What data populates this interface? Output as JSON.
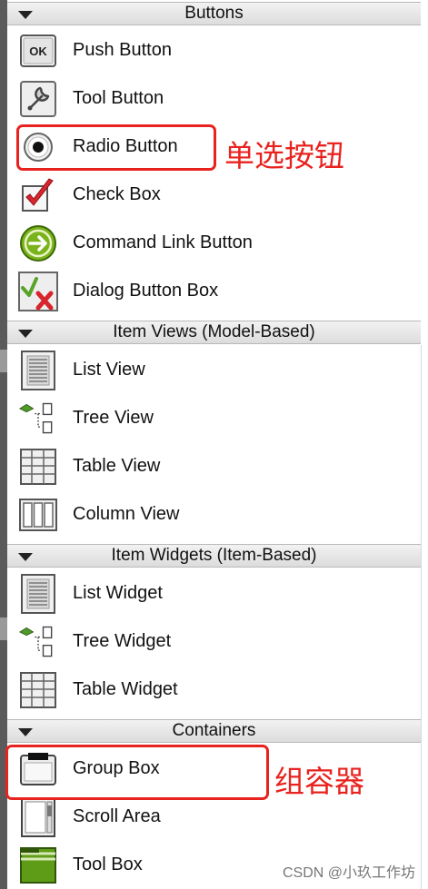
{
  "categories": [
    {
      "title": "Buttons",
      "items": [
        {
          "label": "Push Button",
          "icon": "push-button-icon"
        },
        {
          "label": "Tool Button",
          "icon": "tool-button-icon"
        },
        {
          "label": "Radio Button",
          "icon": "radio-button-icon"
        },
        {
          "label": "Check Box",
          "icon": "check-box-icon"
        },
        {
          "label": "Command Link Button",
          "icon": "command-link-icon"
        },
        {
          "label": "Dialog Button Box",
          "icon": "dialog-button-box-icon"
        }
      ]
    },
    {
      "title": "Item Views (Model-Based)",
      "items": [
        {
          "label": "List View",
          "icon": "list-view-icon"
        },
        {
          "label": "Tree View",
          "icon": "tree-view-icon"
        },
        {
          "label": "Table View",
          "icon": "table-view-icon"
        },
        {
          "label": "Column View",
          "icon": "column-view-icon"
        }
      ]
    },
    {
      "title": "Item Widgets (Item-Based)",
      "items": [
        {
          "label": "List Widget",
          "icon": "list-widget-icon"
        },
        {
          "label": "Tree Widget",
          "icon": "tree-widget-icon"
        },
        {
          "label": "Table Widget",
          "icon": "table-widget-icon"
        }
      ]
    },
    {
      "title": "Containers",
      "items": [
        {
          "label": "Group Box",
          "icon": "group-box-icon"
        },
        {
          "label": "Scroll Area",
          "icon": "scroll-area-icon"
        },
        {
          "label": "Tool Box",
          "icon": "tool-box-icon"
        }
      ]
    }
  ],
  "annotations": {
    "radio": "单选按钮",
    "group": "组容器"
  },
  "push_icon_text": "OK",
  "watermark": "CSDN @小玖工作坊",
  "colors": {
    "annotation": "#e8231f",
    "header_bg": "#e6e6e6",
    "check_red": "#d8242c",
    "command_green": "#7bb31b",
    "toolbox_green": "#5e9b16"
  }
}
